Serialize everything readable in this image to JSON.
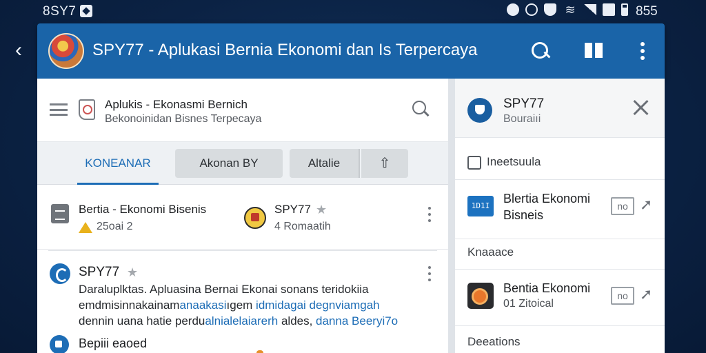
{
  "status_bar": {
    "time": "8SY7",
    "battery_label": "855",
    "icons": [
      "notification-icon",
      "media-icon",
      "alarm-icon",
      "shield-icon",
      "wifi-icon",
      "signal-icon",
      "nfc-icon",
      "battery-icon"
    ]
  },
  "app_bar": {
    "back_glyph": "‹",
    "title": "SPY77 - Aplukasi Bernia Ekonomi dan Is Terpercaya",
    "actions": [
      "search-icon",
      "grid-icon",
      "more-vert-icon"
    ]
  },
  "left_panel": {
    "header": {
      "title": "Aplukis - Ekonasmi Bernich",
      "subtitle": "Bekonoinidan Bisnes Terpecaya"
    },
    "tabs": [
      {
        "label": "KONEANAR",
        "active": true
      },
      {
        "label": "Akonan BY",
        "active": false
      },
      {
        "label": "Altalie",
        "active": false
      },
      {
        "label": "⇧",
        "active": false
      }
    ],
    "feed": [
      {
        "title": "Bertia - Ekonomi Bisenis",
        "date": "25oai 2",
        "author": "SPY77",
        "meta": "4 Romaatih"
      },
      {
        "author": "SPY77",
        "body_line1": "Daraluplktas. Apluasina Bernai Ekonai sonans teridokiia",
        "body_line2_plain": "emdmisinnakainam",
        "body_line2_link": "anaakasi",
        "body_line2_plain2": "ıgem",
        "body_line2_link2": " idmidagai degnviamgah",
        "body_line3_plain": "dennin uana hatie perdu",
        "body_line3_link": "alnialelaiarerh",
        "body_line3_plain2": " aldes, ",
        "body_line3_link2": "danna Beeryi7o"
      },
      {
        "title": "Bepiii eaoed"
      }
    ]
  },
  "right_panel": {
    "header": {
      "title": "SPY77",
      "subtitle": "Bouraiıi"
    },
    "section1_label": "Ineetsuula",
    "card1": {
      "icon_text": "1D1I",
      "title_line1": "Blertia Ekonomi",
      "title_line2": "Bisneis",
      "chip": "no"
    },
    "section2_label": "Knaaace",
    "card2": {
      "title": "Bentia Ekonomi",
      "sub": "01 Zitoical",
      "chip": "no"
    },
    "section3_label": "Deeations"
  },
  "colors": {
    "app_bar": "#1a64a8",
    "accent": "#1d6db6",
    "background": "#0b2244"
  }
}
